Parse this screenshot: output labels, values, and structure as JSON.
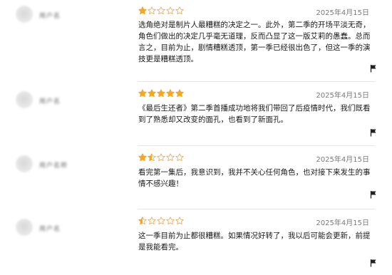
{
  "colors": {
    "star_filled": "#f5a623",
    "star_empty": "#e3b06a",
    "divider": "#e6e6e6"
  },
  "reviews": [
    {
      "username": "用户名",
      "rating": 1,
      "date": "2025年4月15日",
      "text": "选角绝对是制片人最糟糕的决定之一。此外，第二季的开场平淡无奇，角色们做出的决定几乎毫无道理，反而凸显了这一版艾莉的愚蠢。总而言之，目前为止，剧情糟糕透顶，第一季已经很出色了，但这一季的演技更是糟糕透顶。",
      "flag_icon": "flag-icon"
    },
    {
      "username": "用户名",
      "rating": 5,
      "date": "2025年4月15日",
      "text": "《最后生还者》第二季首播成功地将我们带回了后疫情时代，我们既看到了熟悉却又改变的面孔，也看到了新面孔。",
      "flag_icon": "flag-icon"
    },
    {
      "username": "用户名称",
      "rating": 1.5,
      "date": "2025年4月15日",
      "text": "看完第一集后，我意识到，我并不关心任何角色，也对接下来发生的事情不感兴趣！",
      "flag_icon": "flag-icon"
    },
    {
      "username": "用户名",
      "rating": 0.5,
      "date": "2025年4月15日",
      "text": "这一季目前为止都很糟糕。如果情况好转了，我以后可能会更新，前提是我能看完。",
      "flag_icon": "flag-icon"
    }
  ]
}
